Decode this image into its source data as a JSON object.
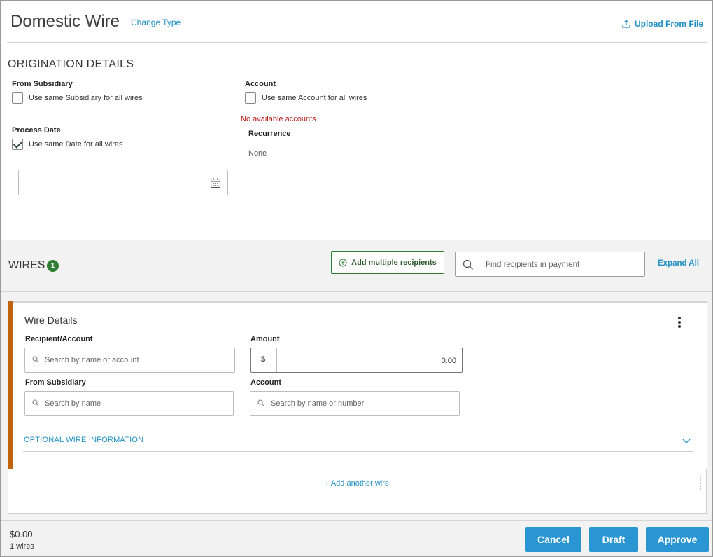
{
  "header": {
    "title": "Domestic Wire",
    "change_type": "Change Type",
    "upload_from_file": "Upload From File"
  },
  "origination": {
    "heading": "ORIGINATION DETAILS",
    "from_subsidiary_label": "From Subsidiary",
    "from_subsidiary_checkbox": "Use same Subsidiary for all wires",
    "account_label": "Account",
    "account_checkbox": "Use same Account for all wires",
    "no_accounts": "No available accounts",
    "process_date_label": "Process Date",
    "process_date_checkbox": "Use same Date for all wires",
    "recurrence_label": "Recurrence",
    "recurrence_value": "None",
    "checked": {
      "subsidiary": false,
      "account": false,
      "date": true
    }
  },
  "wires": {
    "heading": "WIRES",
    "count": "1",
    "add_multiple": "Add multiple recipients",
    "search_placeholder": "Find recipients in payment",
    "expand_all": "Expand All"
  },
  "wire_details": {
    "title": "Wire Details",
    "recipient_label": "Recipient/Account",
    "recipient_placeholder": "Search by name or account.",
    "amount_label": "Amount",
    "currency": "$",
    "amount_value": "0.00",
    "subsidiary_label": "From Subsidiary",
    "subsidiary_placeholder": "Search by name",
    "account_label": "Account",
    "account_placeholder": "Search by name or number",
    "optional_info": "OPTIONAL WIRE INFORMATION",
    "add_another": "+ Add another wire"
  },
  "footer": {
    "total": "$0.00",
    "count_text": "1 wires",
    "cancel": "Cancel",
    "draft": "Draft",
    "approve": "Approve"
  },
  "colors": {
    "accent": "#2996d3",
    "link": "#1f8fc4",
    "badge": "#2e7d32",
    "wire_bar": "#c0620f",
    "error": "#b51c1c"
  }
}
